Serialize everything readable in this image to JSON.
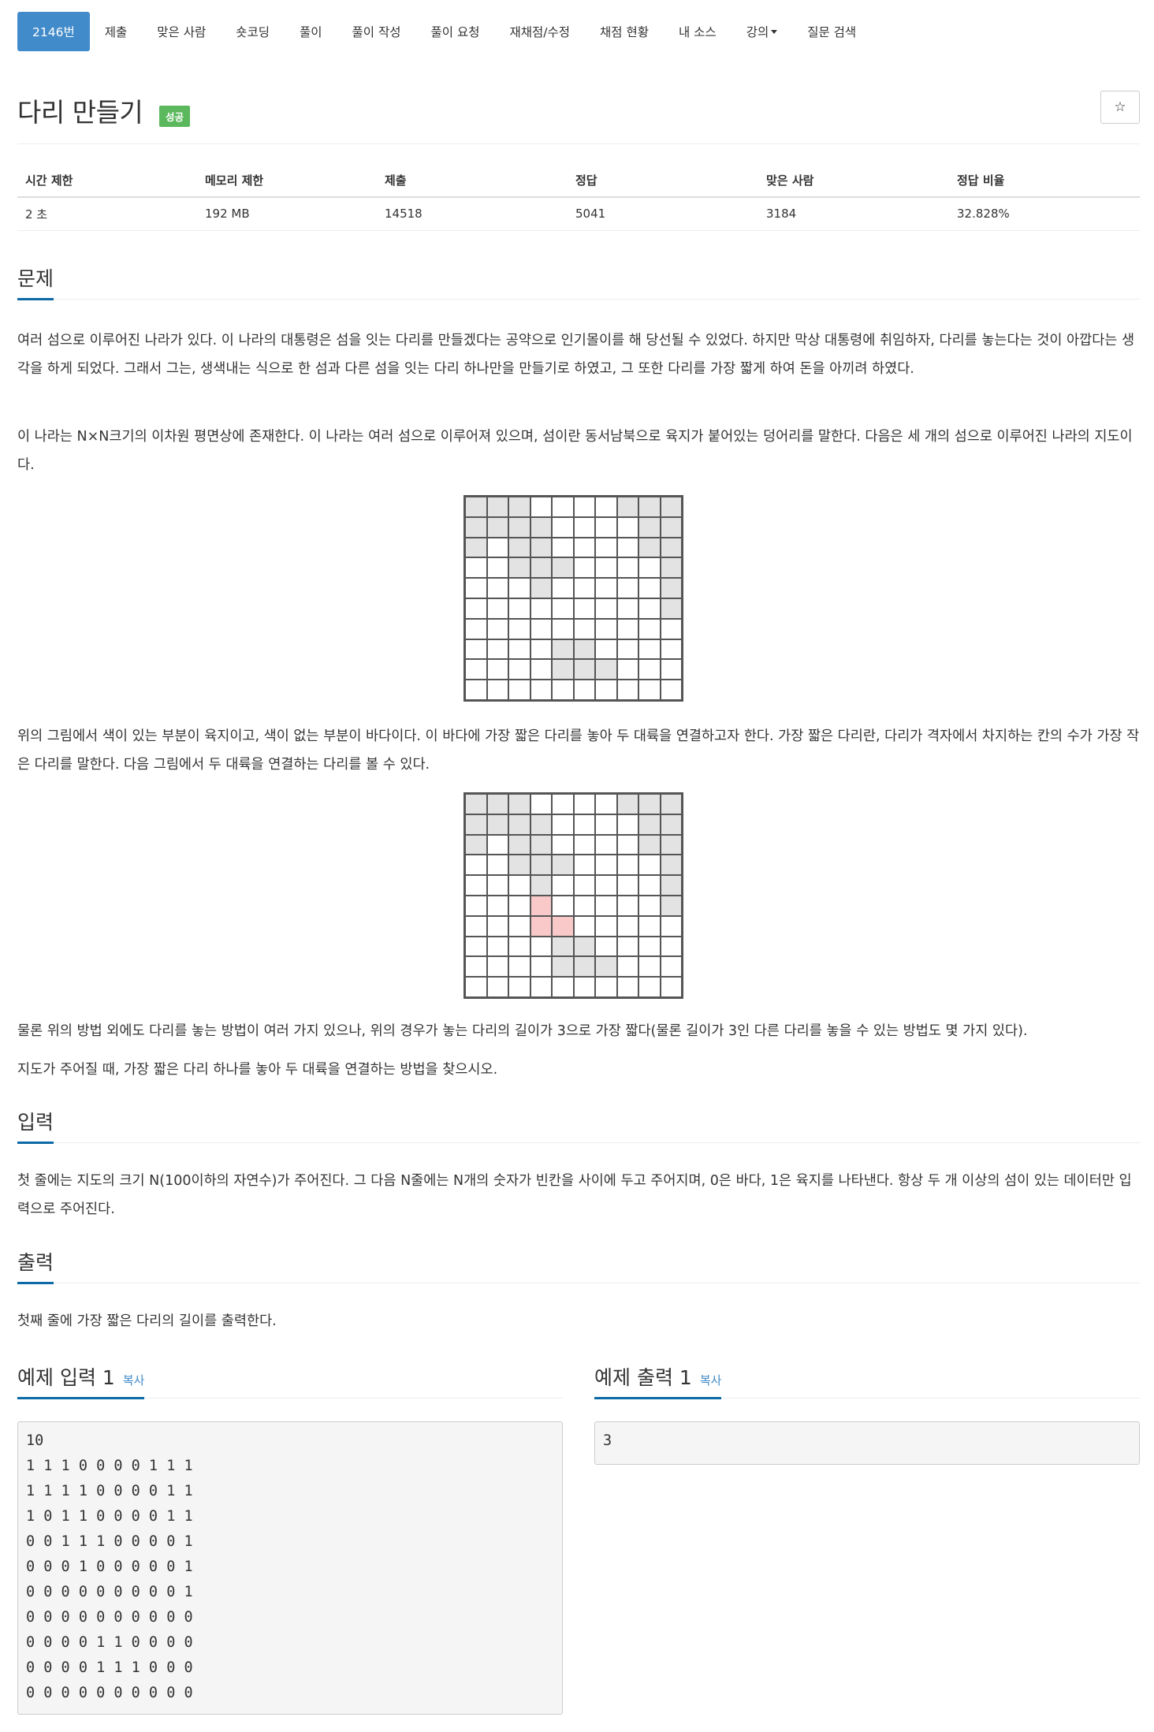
{
  "nav": {
    "tabs": [
      {
        "label": "2146번",
        "active": true
      },
      {
        "label": "제출"
      },
      {
        "label": "맞은 사람"
      },
      {
        "label": "숏코딩"
      },
      {
        "label": "풀이"
      },
      {
        "label": "풀이 작성"
      },
      {
        "label": "풀이 요청"
      },
      {
        "label": "재채점/수정"
      },
      {
        "label": "채점 현황"
      },
      {
        "label": "내 소스"
      },
      {
        "label": "강의",
        "dropdown": true
      },
      {
        "label": "질문 검색"
      }
    ]
  },
  "problem": {
    "title": "다리 만들기",
    "status_badge": "성공",
    "star_icon": "☆"
  },
  "info": {
    "headers": [
      "시간 제한",
      "메모리 제한",
      "제출",
      "정답",
      "맞은 사람",
      "정답 비율"
    ],
    "values": [
      "2 초",
      "192 MB",
      "14518",
      "5041",
      "3184",
      "32.828%"
    ]
  },
  "sections": {
    "problem": {
      "heading": "문제",
      "p1": "여러 섬으로 이루어진 나라가 있다. 이 나라의 대통령은 섬을 잇는 다리를 만들겠다는 공약으로 인기몰이를 해 당선될 수 있었다. 하지만 막상 대통령에 취임하자, 다리를 놓는다는 것이 아깝다는 생각을 하게 되었다. 그래서 그는, 생색내는 식으로 한 섬과 다른 섬을 잇는 다리 하나만을 만들기로 하였고, 그 또한 다리를 가장 짧게 하여 돈을 아끼려 하였다.",
      "p2": "이 나라는 N×N크기의 이차원 평면상에 존재한다. 이 나라는 여러 섬으로 이루어져 있으며, 섬이란 동서남북으로 육지가 붙어있는 덩어리를 말한다. 다음은 세 개의 섬으로 이루어진 나라의 지도이다.",
      "p3": "위의 그림에서 색이 있는 부분이 육지이고, 색이 없는 부분이 바다이다. 이 바다에 가장 짧은 다리를 놓아 두 대륙을 연결하고자 한다. 가장 짧은 다리란, 다리가 격자에서 차지하는 칸의 수가 가장 작은 다리를 말한다. 다음 그림에서 두 대륙을 연결하는 다리를 볼 수 있다.",
      "p4": "물론 위의 방법 외에도 다리를 놓는 방법이 여러 가지 있으나, 위의 경우가 놓는 다리의 길이가 3으로 가장 짧다(물론 길이가 3인 다른 다리를 놓을 수 있는 방법도 몇 가지 있다).",
      "p5": "지도가 주어질 때, 가장 짧은 다리 하나를 놓아 두 대륙을 연결하는 방법을 찾으시오."
    },
    "input": {
      "heading": "입력",
      "text": "첫 줄에는 지도의 크기 N(100이하의 자연수)가 주어진다. 그 다음 N줄에는 N개의 숫자가 빈칸을 사이에 두고 주어지며, 0은 바다, 1은 육지를 나타낸다. 항상 두 개 이상의 섬이 있는 데이터만 입력으로 주어진다."
    },
    "output": {
      "heading": "출력",
      "text": "첫째 줄에 가장 짧은 다리의 길이를 출력한다."
    }
  },
  "map1": [
    "1110000111",
    "1111000011",
    "1011000011",
    "0011100001",
    "0001000001",
    "0000000001",
    "0000000000",
    "0000110000",
    "0000111000",
    "0000000000"
  ],
  "map2": [
    "1110000111",
    "1111000011",
    "1011000011",
    "0011100001",
    "0001000001",
    "0002000001",
    "0002200000",
    "0000110000",
    "0000111000",
    "0000000000"
  ],
  "examples": {
    "input_heading": "예제 입력 1",
    "output_heading": "예제 출력 1",
    "copy_label": "복사",
    "input_text": "10\n1 1 1 0 0 0 0 1 1 1\n1 1 1 1 0 0 0 0 1 1\n1 0 1 1 0 0 0 0 1 1\n0 0 1 1 1 0 0 0 0 1\n0 0 0 1 0 0 0 0 0 1\n0 0 0 0 0 0 0 0 0 1\n0 0 0 0 0 0 0 0 0 0\n0 0 0 0 1 1 0 0 0 0\n0 0 0 0 1 1 1 0 0 0\n0 0 0 0 0 0 0 0 0 0",
    "output_text": "3"
  }
}
